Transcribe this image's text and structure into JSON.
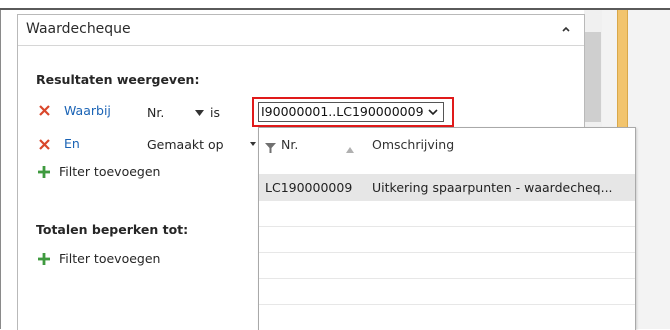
{
  "panel": {
    "title": "Waardecheque"
  },
  "results_section": {
    "title": "Resultaten weergeven:",
    "rows": [
      {
        "connector": "Waarbij",
        "field": "Nr.",
        "operator": "is",
        "value": "I90000001..LC190000009"
      },
      {
        "connector": "En",
        "field": "Gemaakt op"
      }
    ],
    "add_filter": "Filter toevoegen"
  },
  "totals_section": {
    "title": "Totalen beperken tot:",
    "add_filter": "Filter toevoegen"
  },
  "lookup": {
    "columns": [
      "Nr.",
      "Omschrijving"
    ],
    "rows": [
      {
        "nr": "LC190000009",
        "omschrijving": "Uitkering spaarpunten - waardecheq..."
      }
    ]
  },
  "colors": {
    "link": "#1a63b5",
    "remove_icon": "#d9472b",
    "add_icon": "#3f9a3f",
    "highlight_border": "#e01a1a",
    "accent_bar": "#f2c46d"
  }
}
